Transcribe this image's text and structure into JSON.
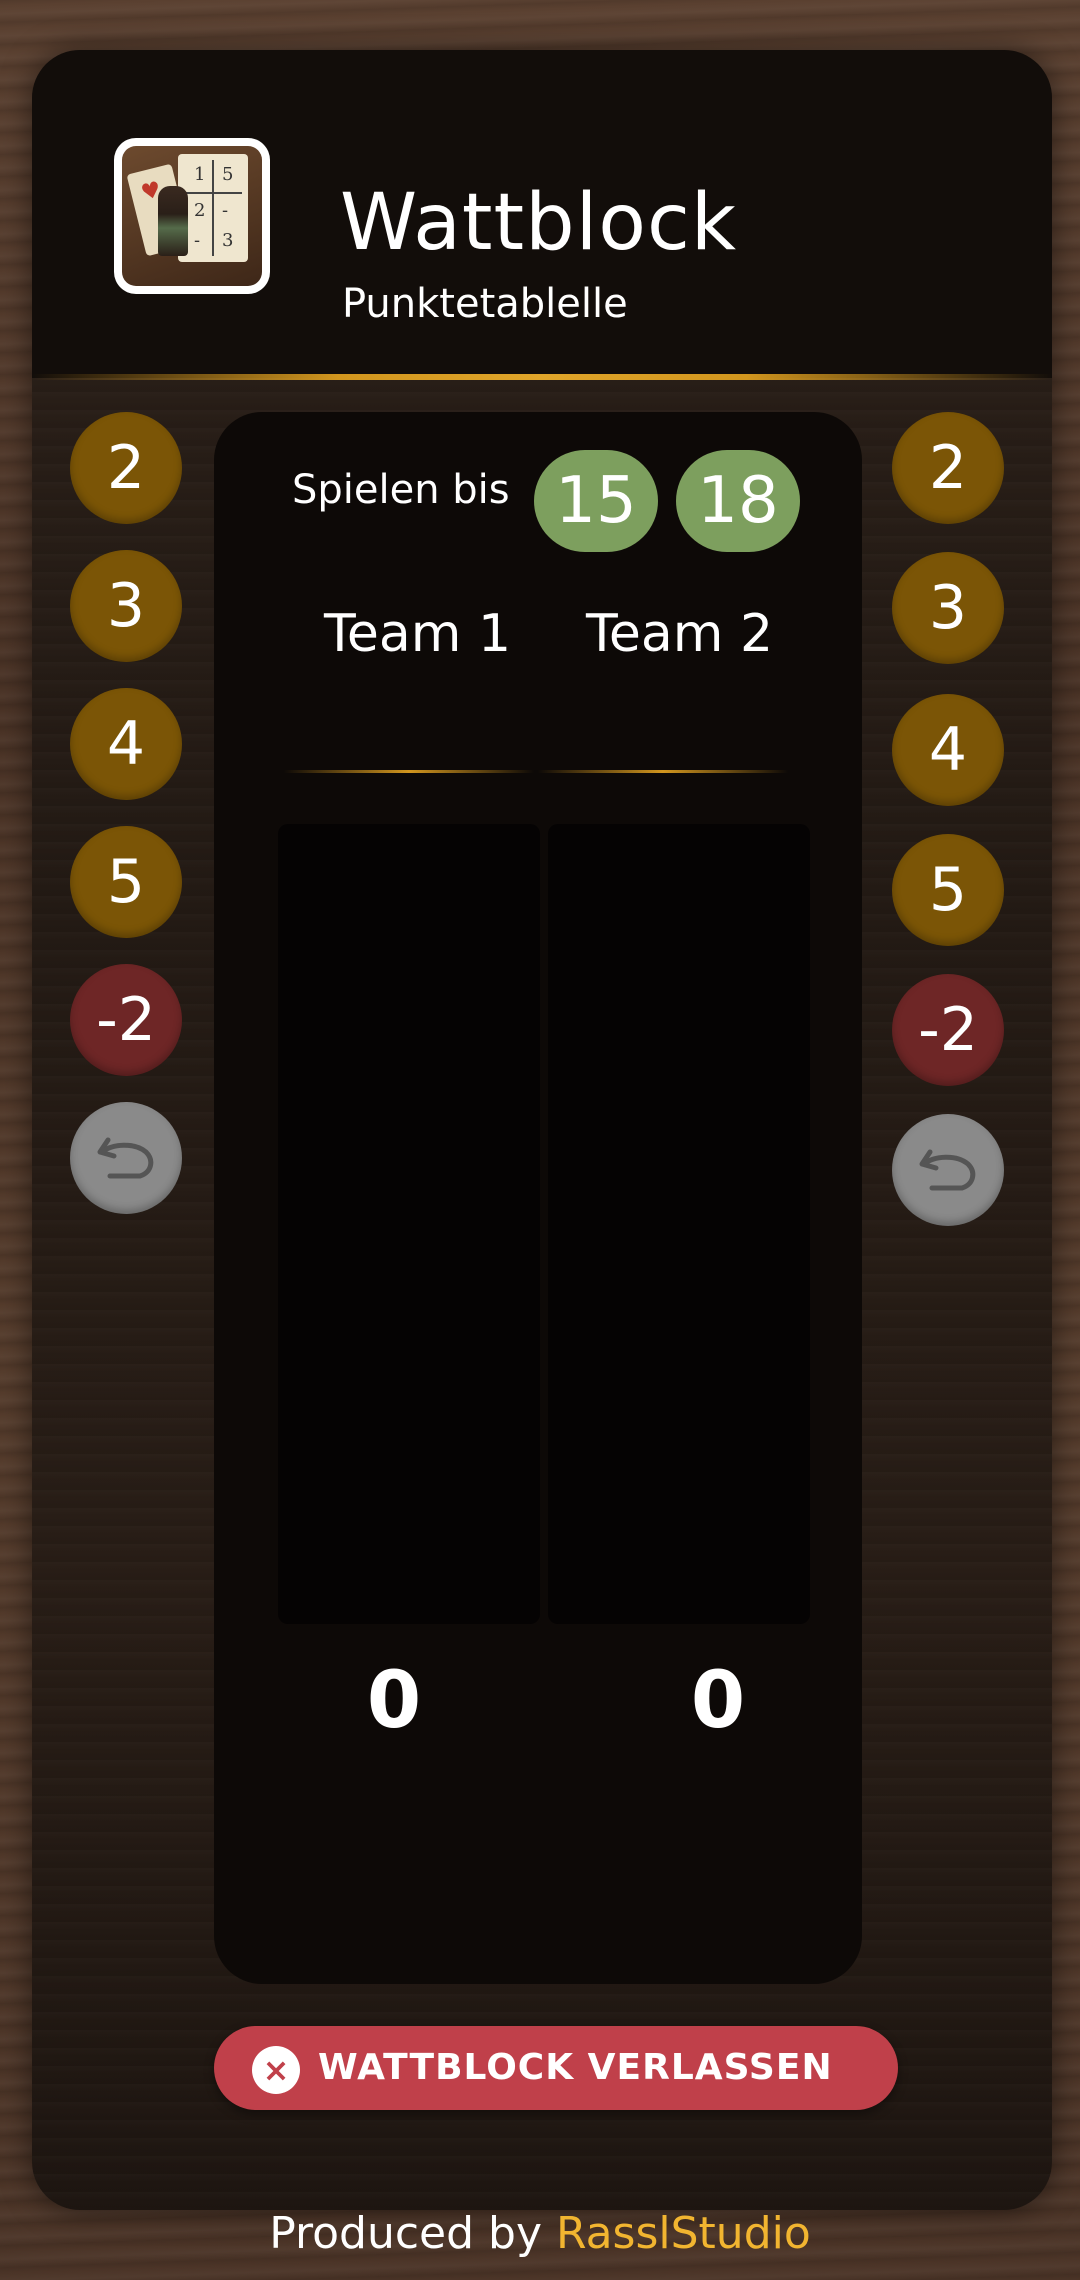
{
  "header": {
    "title": "Wattblock",
    "subtitle": "Punktetablelle"
  },
  "logo": {
    "digits": [
      "1",
      "5",
      "2",
      "-",
      "-",
      "3"
    ]
  },
  "left_buttons": [
    "2",
    "3",
    "4",
    "5",
    "-2"
  ],
  "right_buttons": [
    "2",
    "3",
    "4",
    "5",
    "-2"
  ],
  "game": {
    "play_to_label": "Spielen bis",
    "targets": [
      "15",
      "18"
    ],
    "teams": [
      {
        "name": "Team 1",
        "total": "0"
      },
      {
        "name": "Team 2",
        "total": "0"
      }
    ]
  },
  "leave_button": {
    "label": "WATTBLOCK VERLASSEN"
  },
  "footer": {
    "prefix": "Produced by",
    "brand": "RasslStudio"
  },
  "colors": {
    "gold_button": "#7b5506",
    "minus_button": "#6e2626",
    "undo_button": "#8a8a8a",
    "target_button": "#7d9f5e",
    "leave_button": "#c0404a",
    "brand": "#f2b530"
  },
  "icons": {
    "undo": "undo-icon",
    "close": "close-icon"
  }
}
